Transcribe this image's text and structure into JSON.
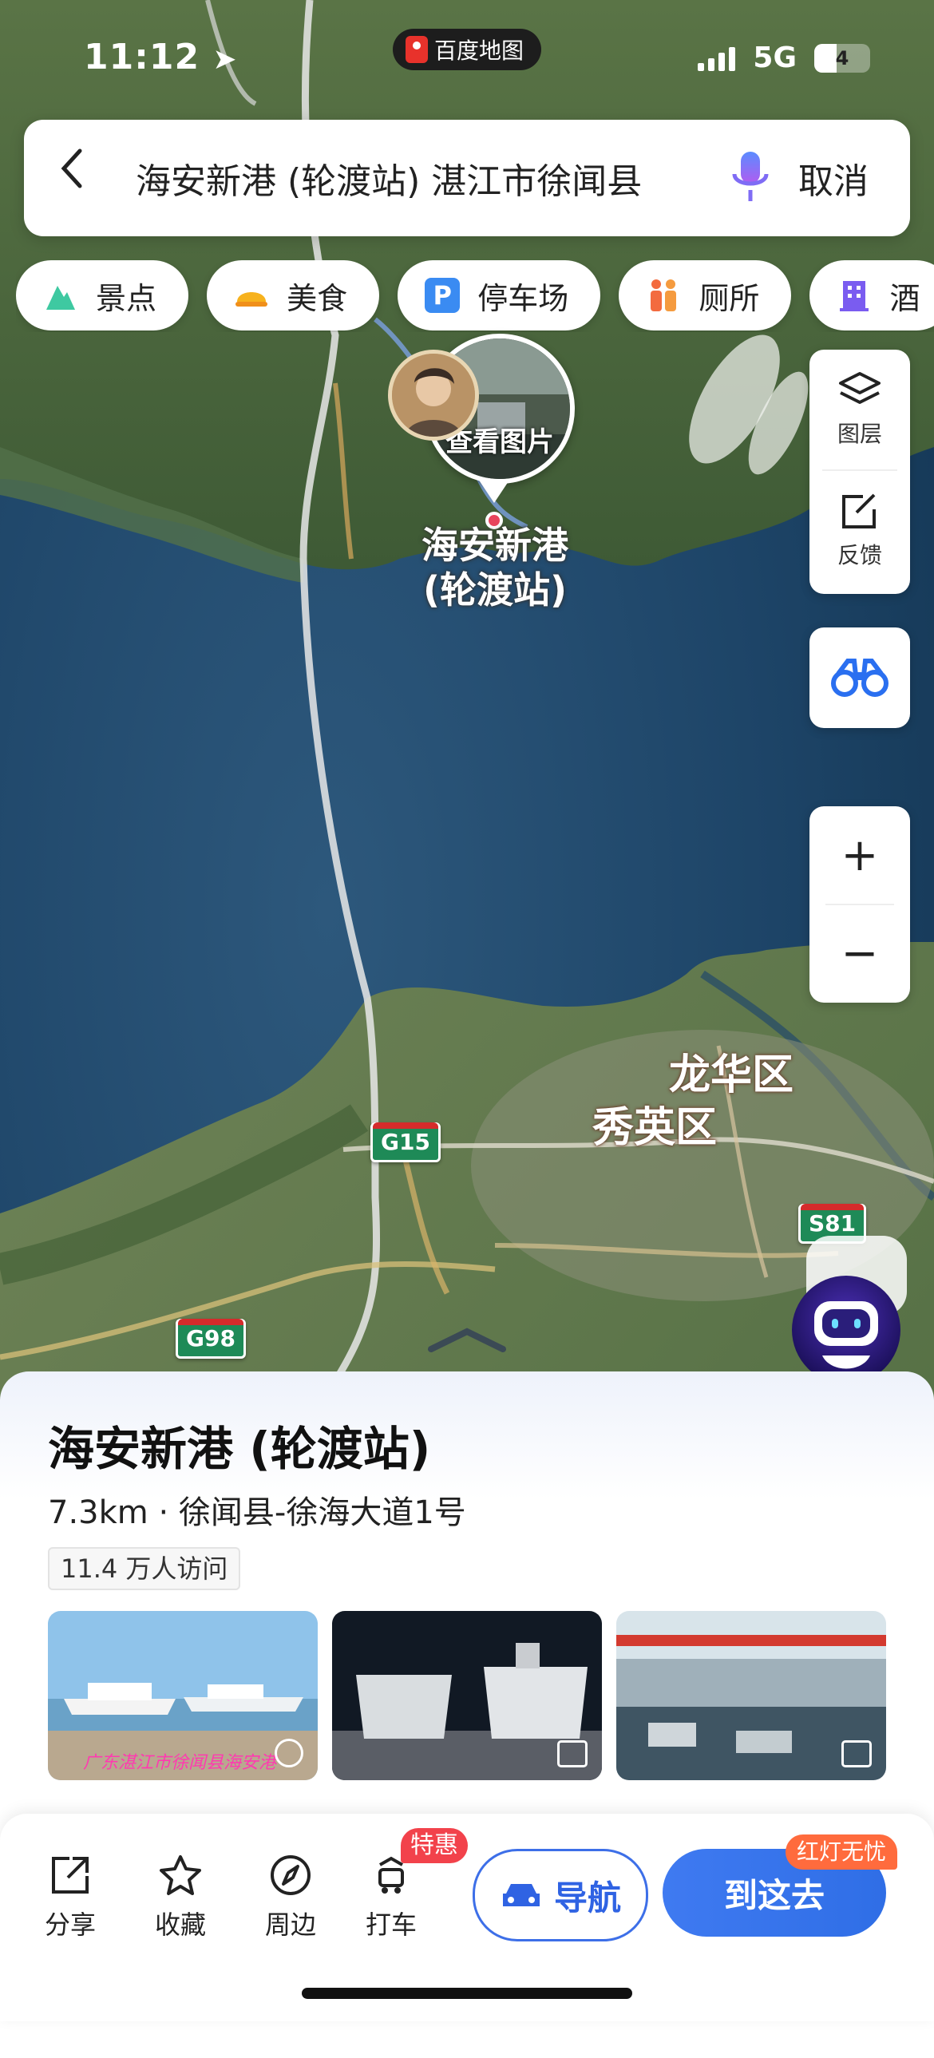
{
  "status_bar": {
    "time": "11:12",
    "app_badge": "百度地图",
    "network": "5G",
    "battery": "4"
  },
  "search_bar": {
    "query": "海安新港 (轮渡站) 湛江市徐闻县",
    "cancel_label": "取消"
  },
  "categories": [
    {
      "label": "景点",
      "icon": "mountain-icon"
    },
    {
      "label": "美食",
      "icon": "food-icon"
    },
    {
      "label": "停车场",
      "icon": "parking-icon"
    },
    {
      "label": "厕所",
      "icon": "toilet-icon"
    },
    {
      "label": "酒",
      "icon": "hotel-icon"
    }
  ],
  "map_controls": {
    "layers_label": "图层",
    "feedback_label": "反馈",
    "zoom_in": "+",
    "zoom_out": "−"
  },
  "map_marker": {
    "view_photos_label": "查看图片",
    "poi_label_line1": "海安新港",
    "poi_label_line2": "(轮渡站)"
  },
  "map_labels": {
    "district_1": "龙华区",
    "district_2": "秀英区",
    "road_g15": "G15",
    "road_g98": "G98",
    "road_s81": "S81"
  },
  "poi_card": {
    "title": "海安新港 (轮渡站)",
    "subtitle": "7.3km · 徐闻县-徐海大道1号",
    "visits": "11.4 万人访问",
    "photo_caption": "广东湛江市徐闻县海安港"
  },
  "bottom_actions": [
    {
      "label": "分享",
      "icon": "share-icon"
    },
    {
      "label": "收藏",
      "icon": "star-icon"
    },
    {
      "label": "周边",
      "icon": "compass-icon"
    },
    {
      "label": "打车",
      "icon": "taxi-icon"
    }
  ],
  "promo_badge": "特惠",
  "navigate_label": "导航",
  "go_here_label": "到这去",
  "traffic_badge": "红灯无忧",
  "colors": {
    "accent": "#3d6fe8",
    "promo": "#f2424b",
    "water": "#1c4468",
    "land": "#4f6b3e"
  }
}
